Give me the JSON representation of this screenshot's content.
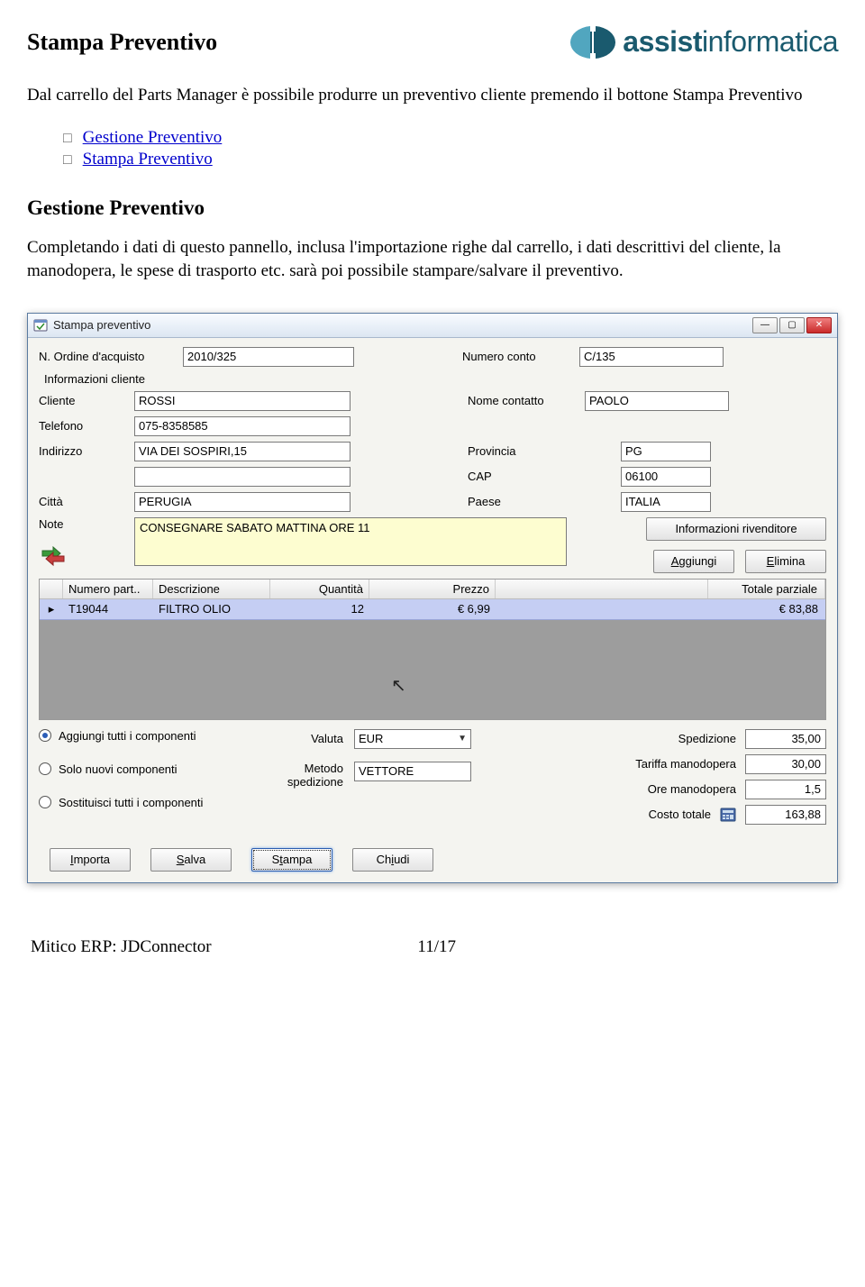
{
  "doc": {
    "title": "Stampa Preventivo",
    "intro": "Dal carrello del Parts Manager è possibile produrre un preventivo cliente premendo il bottone Stampa Preventivo",
    "links": {
      "gestione": "Gestione Preventivo",
      "stampa": "Stampa Preventivo"
    },
    "section_title": "Gestione Preventivo",
    "section_desc": "Completando i dati di questo pannello, inclusa l'importazione righe dal carrello, i dati descrittivi del cliente, la manodopera, le spese di trasporto etc. sarà poi possibile stampare/salvare il preventivo."
  },
  "logo": {
    "brand_bold": "assist",
    "brand_light": "informatica"
  },
  "win": {
    "title": "Stampa preventivo",
    "labels": {
      "n_ordine": "N. Ordine d'acquisto",
      "numero_conto": "Numero conto",
      "info_cliente": "Informazioni cliente",
      "cliente": "Cliente",
      "nome_contatto": "Nome contatto",
      "telefono": "Telefono",
      "indirizzo": "Indirizzo",
      "provincia": "Provincia",
      "cap": "CAP",
      "citta": "Città",
      "paese": "Paese",
      "note": "Note",
      "valuta": "Valuta",
      "metodo_spedizione": "Metodo spedizione",
      "spedizione": "Spedizione",
      "tariffa_manodopera": "Tariffa manodopera",
      "ore_manodopera": "Ore manodopera",
      "costo_totale": "Costo totale"
    },
    "values": {
      "n_ordine": "2010/325",
      "numero_conto": "C/135",
      "cliente": "ROSSI",
      "nome_contatto": "PAOLO",
      "telefono": "075-8358585",
      "indirizzo": "VIA DEI SOSPIRI,15",
      "indirizzo2": "",
      "provincia": "PG",
      "cap": "06100",
      "citta": "PERUGIA",
      "paese": "ITALIA",
      "note": "CONSEGNARE SABATO MATTINA ORE 11",
      "valuta": "EUR",
      "metodo_spedizione": "VETTORE",
      "spedizione": "35,00",
      "tariffa_manodopera": "30,00",
      "ore_manodopera": "1,5",
      "costo_totale": "163,88"
    },
    "buttons": {
      "info_rivenditore": "Informazioni rivenditore",
      "aggiungi": "Aggiungi",
      "elimina": "Elimina",
      "importa": "Importa",
      "salva": "Salva",
      "stampa": "Stampa",
      "chiudi": "Chiudi"
    },
    "radios": {
      "aggiungi_tutti": "Aggiungi tutti i componenti",
      "solo_nuovi": "Solo nuovi componenti",
      "sostituisci": "Sostituisci tutti i componenti"
    },
    "grid": {
      "headers": {
        "numero_part": "Numero part..",
        "descrizione": "Descrizione",
        "quantita": "Quantità",
        "prezzo": "Prezzo",
        "totale_parziale": "Totale parziale"
      },
      "rows": [
        {
          "numero_part": "T19044",
          "descrizione": "FILTRO OLIO",
          "quantita": "12",
          "prezzo": "€ 6,99",
          "totale_parziale": "€ 83,88"
        }
      ]
    }
  },
  "footer": {
    "left": "Mitico ERP: JDConnector",
    "page": "11/17"
  }
}
